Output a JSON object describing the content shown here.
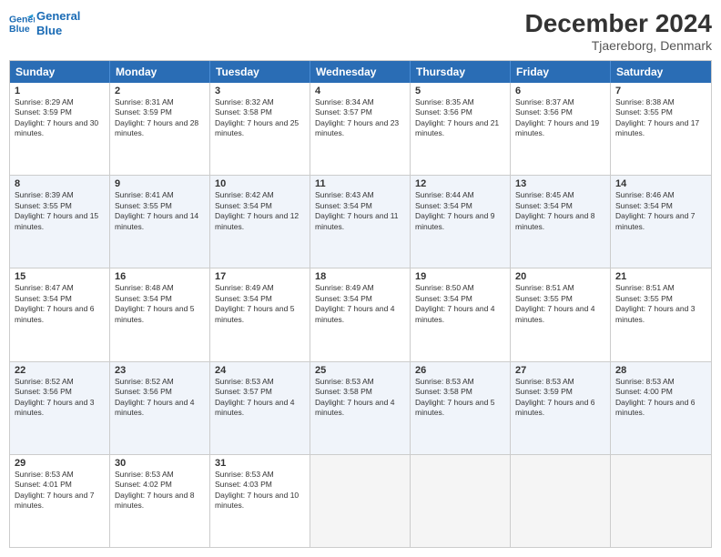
{
  "header": {
    "logo_line1": "General",
    "logo_line2": "Blue",
    "month_year": "December 2024",
    "location": "Tjaereborg, Denmark"
  },
  "weekdays": [
    "Sunday",
    "Monday",
    "Tuesday",
    "Wednesday",
    "Thursday",
    "Friday",
    "Saturday"
  ],
  "rows": [
    [
      {
        "day": "1",
        "sunrise": "8:29 AM",
        "sunset": "3:59 PM",
        "daylight": "7 hours and 30 minutes."
      },
      {
        "day": "2",
        "sunrise": "8:31 AM",
        "sunset": "3:59 PM",
        "daylight": "7 hours and 28 minutes."
      },
      {
        "day": "3",
        "sunrise": "8:32 AM",
        "sunset": "3:58 PM",
        "daylight": "7 hours and 25 minutes."
      },
      {
        "day": "4",
        "sunrise": "8:34 AM",
        "sunset": "3:57 PM",
        "daylight": "7 hours and 23 minutes."
      },
      {
        "day": "5",
        "sunrise": "8:35 AM",
        "sunset": "3:56 PM",
        "daylight": "7 hours and 21 minutes."
      },
      {
        "day": "6",
        "sunrise": "8:37 AM",
        "sunset": "3:56 PM",
        "daylight": "7 hours and 19 minutes."
      },
      {
        "day": "7",
        "sunrise": "8:38 AM",
        "sunset": "3:55 PM",
        "daylight": "7 hours and 17 minutes."
      }
    ],
    [
      {
        "day": "8",
        "sunrise": "8:39 AM",
        "sunset": "3:55 PM",
        "daylight": "7 hours and 15 minutes."
      },
      {
        "day": "9",
        "sunrise": "8:41 AM",
        "sunset": "3:55 PM",
        "daylight": "7 hours and 14 minutes."
      },
      {
        "day": "10",
        "sunrise": "8:42 AM",
        "sunset": "3:54 PM",
        "daylight": "7 hours and 12 minutes."
      },
      {
        "day": "11",
        "sunrise": "8:43 AM",
        "sunset": "3:54 PM",
        "daylight": "7 hours and 11 minutes."
      },
      {
        "day": "12",
        "sunrise": "8:44 AM",
        "sunset": "3:54 PM",
        "daylight": "7 hours and 9 minutes."
      },
      {
        "day": "13",
        "sunrise": "8:45 AM",
        "sunset": "3:54 PM",
        "daylight": "7 hours and 8 minutes."
      },
      {
        "day": "14",
        "sunrise": "8:46 AM",
        "sunset": "3:54 PM",
        "daylight": "7 hours and 7 minutes."
      }
    ],
    [
      {
        "day": "15",
        "sunrise": "8:47 AM",
        "sunset": "3:54 PM",
        "daylight": "7 hours and 6 minutes."
      },
      {
        "day": "16",
        "sunrise": "8:48 AM",
        "sunset": "3:54 PM",
        "daylight": "7 hours and 5 minutes."
      },
      {
        "day": "17",
        "sunrise": "8:49 AM",
        "sunset": "3:54 PM",
        "daylight": "7 hours and 5 minutes."
      },
      {
        "day": "18",
        "sunrise": "8:49 AM",
        "sunset": "3:54 PM",
        "daylight": "7 hours and 4 minutes."
      },
      {
        "day": "19",
        "sunrise": "8:50 AM",
        "sunset": "3:54 PM",
        "daylight": "7 hours and 4 minutes."
      },
      {
        "day": "20",
        "sunrise": "8:51 AM",
        "sunset": "3:55 PM",
        "daylight": "7 hours and 4 minutes."
      },
      {
        "day": "21",
        "sunrise": "8:51 AM",
        "sunset": "3:55 PM",
        "daylight": "7 hours and 3 minutes."
      }
    ],
    [
      {
        "day": "22",
        "sunrise": "8:52 AM",
        "sunset": "3:56 PM",
        "daylight": "7 hours and 3 minutes."
      },
      {
        "day": "23",
        "sunrise": "8:52 AM",
        "sunset": "3:56 PM",
        "daylight": "7 hours and 4 minutes."
      },
      {
        "day": "24",
        "sunrise": "8:53 AM",
        "sunset": "3:57 PM",
        "daylight": "7 hours and 4 minutes."
      },
      {
        "day": "25",
        "sunrise": "8:53 AM",
        "sunset": "3:58 PM",
        "daylight": "7 hours and 4 minutes."
      },
      {
        "day": "26",
        "sunrise": "8:53 AM",
        "sunset": "3:58 PM",
        "daylight": "7 hours and 5 minutes."
      },
      {
        "day": "27",
        "sunrise": "8:53 AM",
        "sunset": "3:59 PM",
        "daylight": "7 hours and 6 minutes."
      },
      {
        "day": "28",
        "sunrise": "8:53 AM",
        "sunset": "4:00 PM",
        "daylight": "7 hours and 6 minutes."
      }
    ],
    [
      {
        "day": "29",
        "sunrise": "8:53 AM",
        "sunset": "4:01 PM",
        "daylight": "7 hours and 7 minutes."
      },
      {
        "day": "30",
        "sunrise": "8:53 AM",
        "sunset": "4:02 PM",
        "daylight": "7 hours and 8 minutes."
      },
      {
        "day": "31",
        "sunrise": "8:53 AM",
        "sunset": "4:03 PM",
        "daylight": "7 hours and 10 minutes."
      },
      null,
      null,
      null,
      null
    ]
  ]
}
